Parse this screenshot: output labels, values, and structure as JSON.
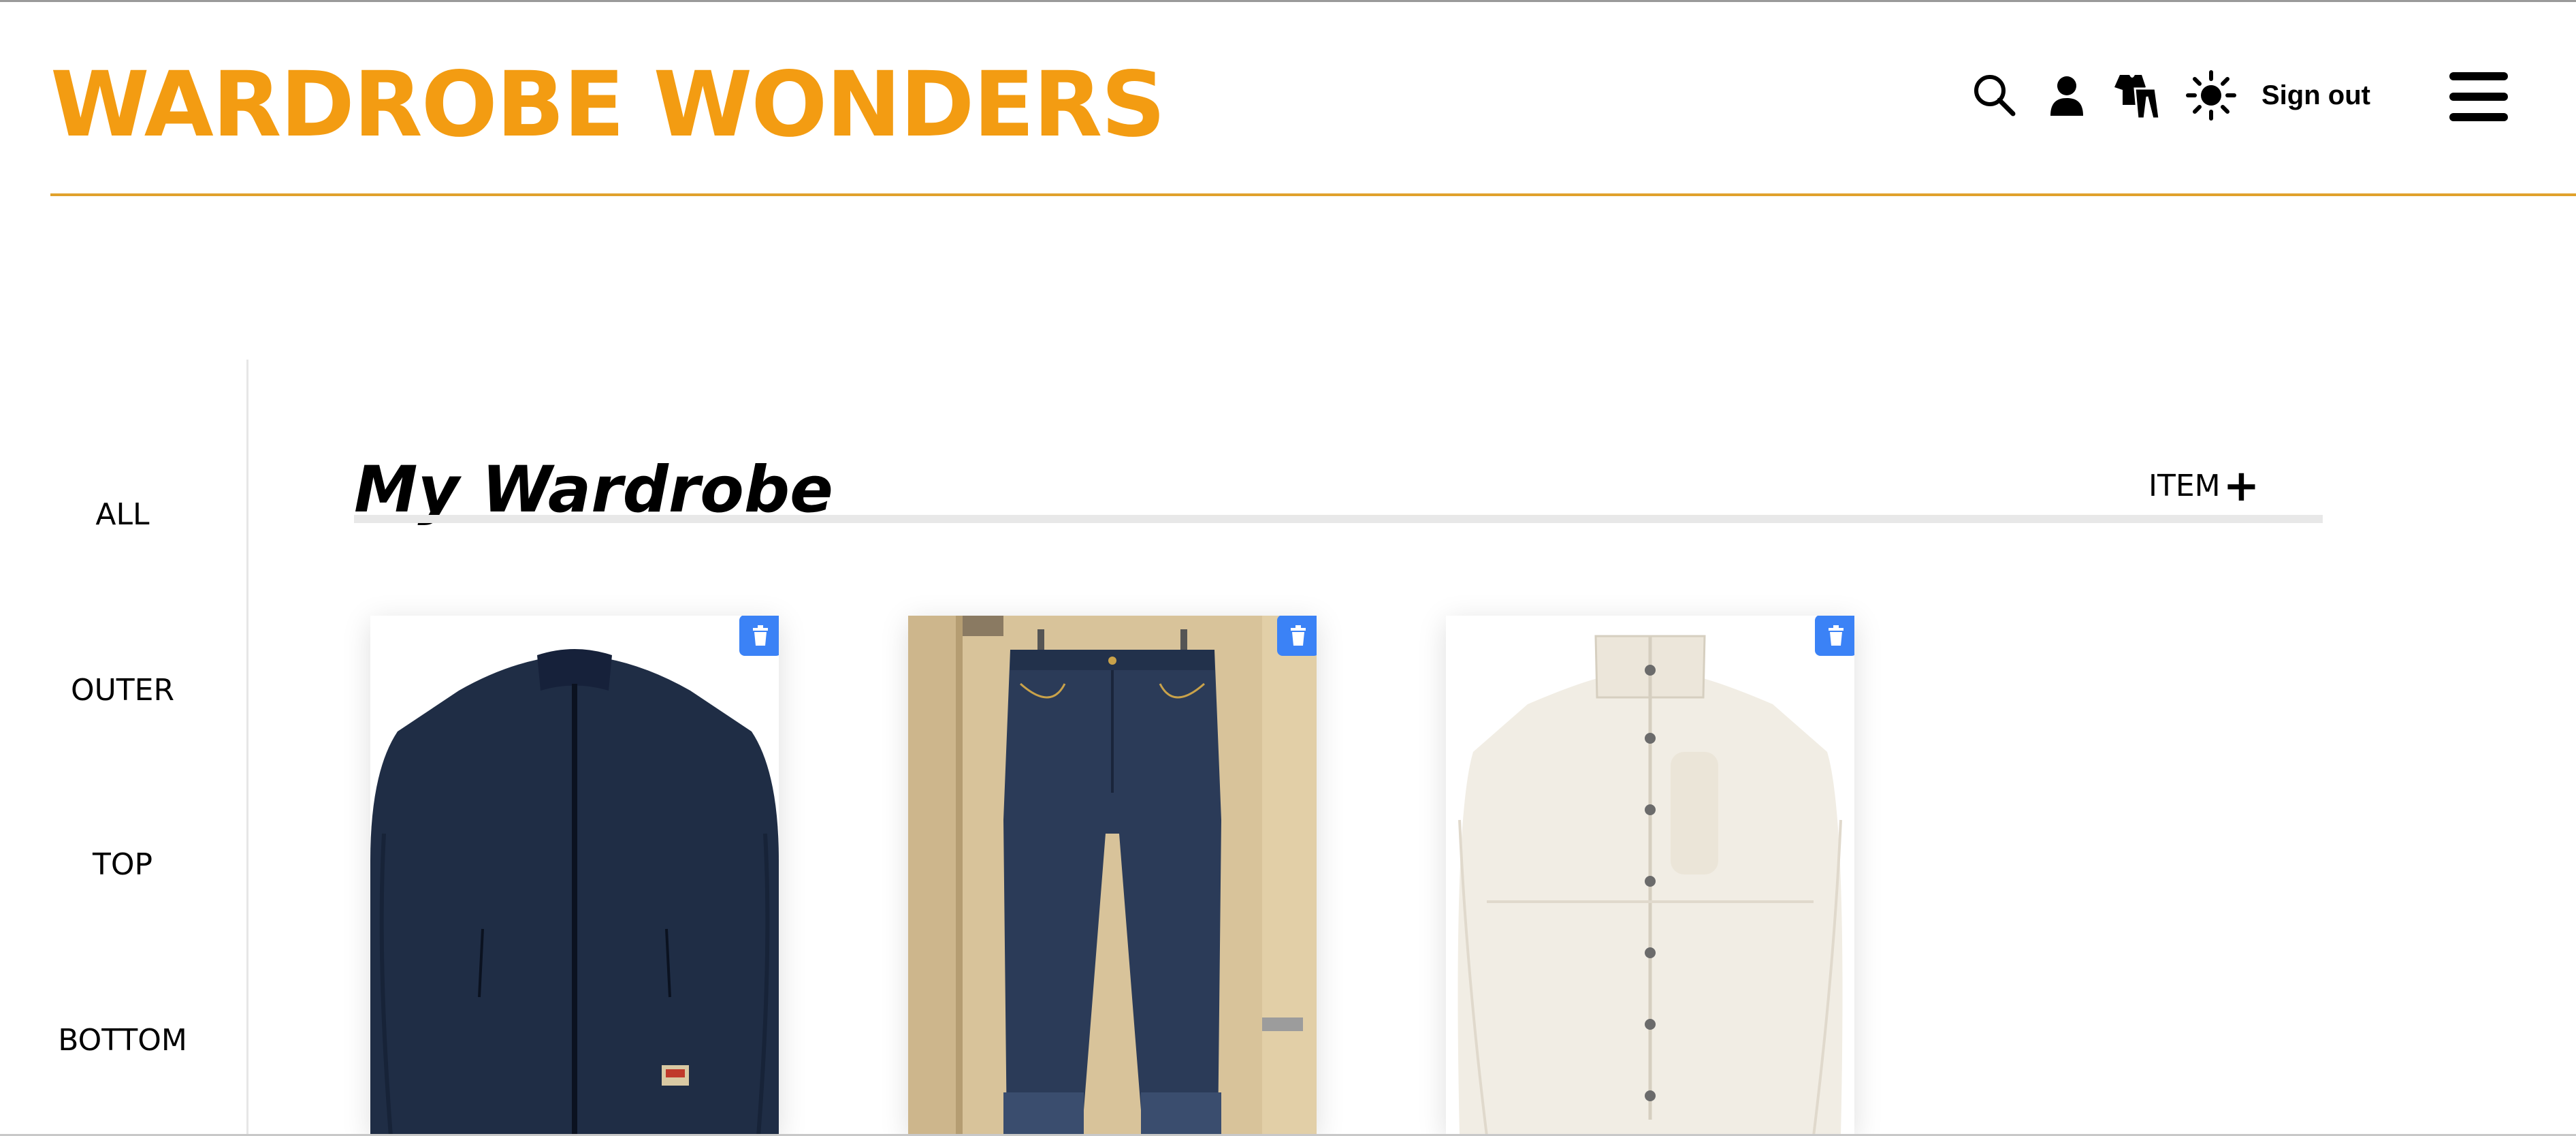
{
  "app": {
    "logo_text": "WARDROBE WONDERS",
    "accent_color": "#f39c12"
  },
  "header": {
    "icons": [
      "search-icon",
      "user-icon",
      "wardrobe-icon",
      "sun-icon"
    ],
    "signout_label": "Sign out",
    "menu_icon": "hamburger-icon"
  },
  "sidebar": {
    "items": [
      {
        "label": "ALL"
      },
      {
        "label": "OUTER"
      },
      {
        "label": "TOP"
      },
      {
        "label": "BOTTOM"
      }
    ]
  },
  "main": {
    "title": "My Wardrobe",
    "add_item_label": "ITEM",
    "add_item_icon": "+",
    "items": [
      {
        "category": "outer",
        "description": "navy fleece zip jacket"
      },
      {
        "category": "bottom",
        "description": "dark denim jeans"
      },
      {
        "category": "outer",
        "description": "cream fleece snap jacket"
      }
    ],
    "delete_color": "#3b82f6"
  }
}
